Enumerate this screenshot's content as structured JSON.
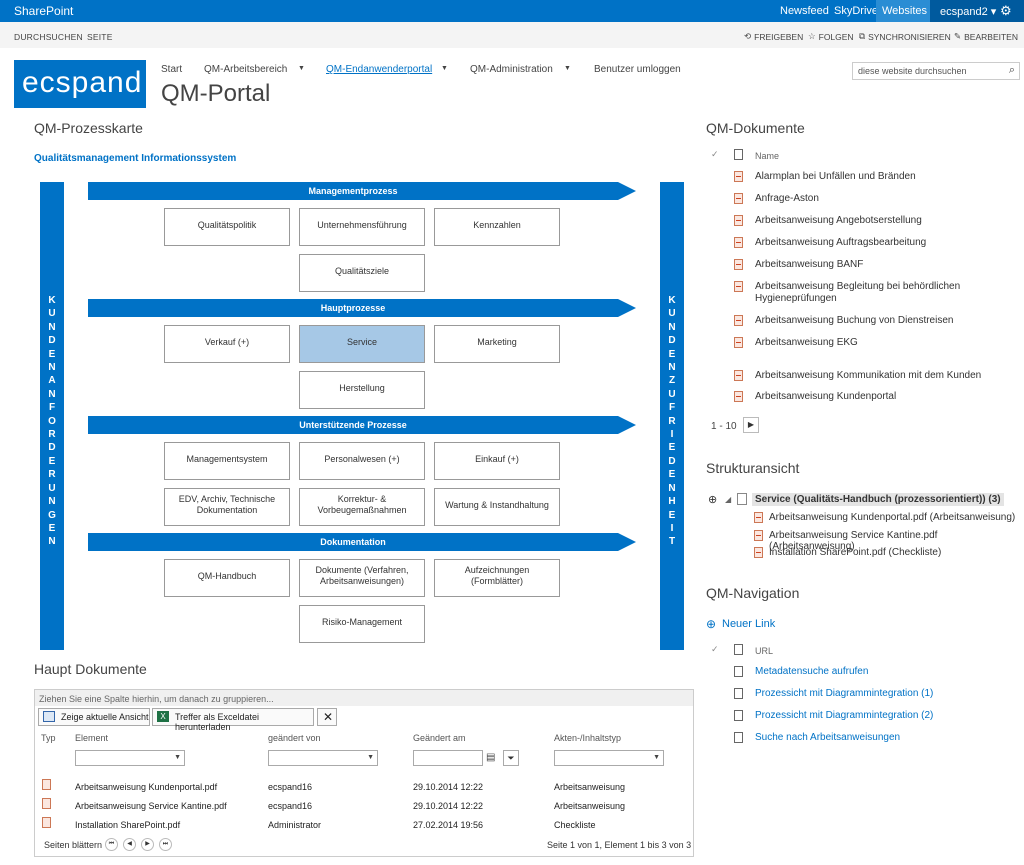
{
  "suitebar": {
    "brand": "SharePoint",
    "links": [
      "Newsfeed",
      "SkyDrive",
      "Websites"
    ],
    "user": "ecspand2 ▾",
    "settings_icon": "gear-icon"
  },
  "ribbon": {
    "tabs": [
      "DURCHSUCHEN",
      "SEITE"
    ],
    "actions": [
      "FREIGEBEN",
      "FOLGEN",
      "SYNCHRONISIEREN",
      "BEARBEITEN"
    ]
  },
  "header": {
    "logo": "ecspand",
    "nav": [
      "Start",
      "QM-Arbeitsbereich",
      "QM-Endanwenderportal",
      "QM-Administration",
      "Benutzer umloggen"
    ],
    "current_nav": "QM-Endanwenderportal",
    "title": "QM-Portal",
    "search_placeholder": "diese website durchsuchen"
  },
  "prozesskarte": {
    "heading": "QM-Prozesskarte",
    "subtitle": "Qualitätsmanagement Informationssystem",
    "left_bar": "KUNDENANFORDERUNGEN",
    "right_bar": "KUNDENZUFRIEDENHEIT",
    "sections": [
      {
        "title": "Managementprozess",
        "items": [
          "Qualitätspolitik",
          "Unternehmensführung",
          "Kennzahlen",
          "Qualitätsziele"
        ]
      },
      {
        "title": "Hauptprozesse",
        "items": [
          "Verkauf (+)",
          "Service",
          "Marketing",
          "Herstellung"
        ]
      },
      {
        "title": "Unterstützende Prozesse",
        "items": [
          "Managementsystem",
          "Personalwesen (+)",
          "Einkauf (+)",
          "EDV, Archiv, Technische Dokumentation",
          "Korrektur- & Vorbeugemaßnahmen",
          "Wartung & Instandhaltung"
        ]
      },
      {
        "title": "Dokumentation",
        "items": [
          "QM-Handbuch",
          "Dokumente (Verfahren, Arbeitsanweisungen)",
          "Aufzeichnungen (Formblätter)",
          "Risiko-Management"
        ]
      }
    ],
    "selected": "Service"
  },
  "qm_dokumente": {
    "heading": "QM-Dokumente",
    "column": "Name",
    "items": [
      "Alarmplan bei Unfällen und Bränden",
      "Anfrage-Aston",
      "Arbeitsanweisung Angebotserstellung",
      "Arbeitsanweisung Auftragsbearbeitung",
      "Arbeitsanweisung BANF",
      "Arbeitsanweisung Begleitung bei behördlichen Hygieneprüfungen",
      "Arbeitsanweisung Buchung von Dienstreisen",
      "Arbeitsanweisung EKG",
      "Arbeitsanweisung Kommunikation mit dem Kunden",
      "Arbeitsanweisung Kundenportal"
    ],
    "pager": "1 - 10"
  },
  "strukturansicht": {
    "heading": "Strukturansicht",
    "root": "Service (Qualitäts-Handbuch (prozessorientiert)) (3)",
    "children": [
      "Arbeitsanweisung Kundenportal.pdf (Arbeitsanweisung)",
      "Arbeitsanweisung Service Kantine.pdf (Arbeitsanweisung)",
      "Installation SharePoint.pdf (Checkliste)"
    ]
  },
  "qm_navigation": {
    "heading": "QM-Navigation",
    "new_link": "Neuer Link",
    "column": "URL",
    "links": [
      "Metadatensuche aufrufen",
      "Prozessicht mit Diagrammintegration (1)",
      "Prozessicht mit Diagrammintegration (2)",
      "Suche nach Arbeitsanweisungen"
    ]
  },
  "haupt_dokumente": {
    "heading": "Haupt Dokumente",
    "group_hint": "Ziehen Sie eine Spalte hierhin, um danach zu gruppieren...",
    "btn_view": "Zeige aktuelle Ansicht",
    "btn_excel": "Treffer als Exceldatei herunterladen",
    "columns": [
      "Typ",
      "Element",
      "geändert von",
      "Geändert am",
      "Akten-/Inhaltstyp"
    ],
    "rows": [
      {
        "element": "Arbeitsanweisung Kundenportal.pdf",
        "by": "ecspand16",
        "date": "29.10.2014 12:22",
        "type": "Arbeitsanweisung"
      },
      {
        "element": "Arbeitsanweisung Service Kantine.pdf",
        "by": "ecspand16",
        "date": "29.10.2014 12:22",
        "type": "Arbeitsanweisung"
      },
      {
        "element": "Installation SharePoint.pdf",
        "by": "Administrator",
        "date": "27.02.2014 19:56",
        "type": "Checkliste"
      }
    ],
    "paging_label": "Seiten blättern",
    "paging_info": "Seite 1 von 1, Element 1 bis 3 von 3"
  },
  "colors": {
    "accent": "#0072c6",
    "selected_box": "#a6c8e6"
  }
}
